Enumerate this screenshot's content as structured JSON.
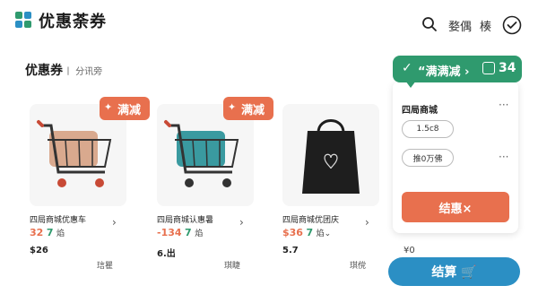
{
  "header": {
    "app_title": "优惠荼券",
    "nav_a": "婺偶",
    "nav_b": "楱"
  },
  "section": {
    "title": "优惠券",
    "subtitle": "丨 分讯旁"
  },
  "products": [
    {
      "tag": "满减",
      "name": "四局商城优惠车",
      "price1": "32",
      "price2": "7",
      "price3": "焰",
      "sub": "$26",
      "action": "琂瞿"
    },
    {
      "tag": "满减",
      "name": "四局商城认惠暑",
      "price1": "-134",
      "price2": "7",
      "price3": "焰",
      "sub": "6.出",
      "action": "琪睫"
    },
    {
      "tag": "",
      "name": "四局商城优团庆",
      "price1": "$36",
      "price2": "7",
      "price3": "焰⌄",
      "sub": "5.7",
      "action": "琪傥"
    }
  ],
  "panel": {
    "banner_check": "✓",
    "banner_text": "“满满减 ›",
    "banner_count": "34",
    "title": "四局商城",
    "pill1": "1.5c8",
    "pill2": "推0万佛",
    "apply_label": "结惠×"
  },
  "cart": {
    "yen": "¥0",
    "checkout_label": "结算 🛒"
  },
  "colors": {
    "accent_orange": "#e8704e",
    "accent_green": "#2f9a6e",
    "accent_blue": "#2b8fc4"
  },
  "icons": [
    "logo-icon",
    "search-icon",
    "check-circle-icon",
    "cart-icon",
    "handbag-icon",
    "chevron-right-icon",
    "more-dots-icon"
  ]
}
